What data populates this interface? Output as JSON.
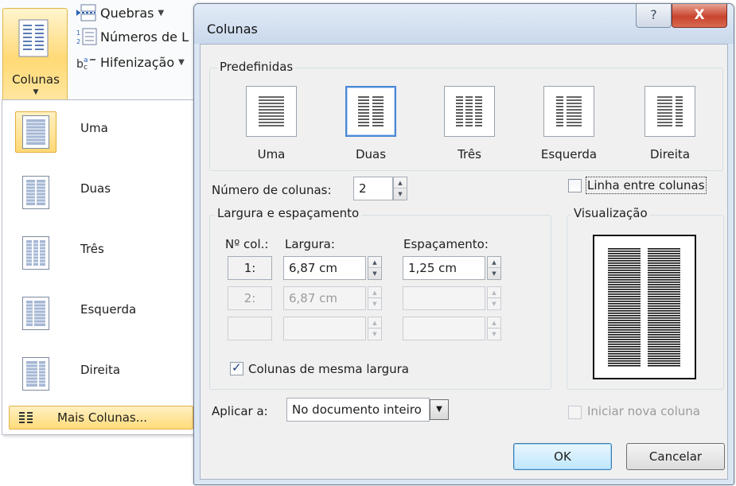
{
  "ribbon": {
    "colunas_label": "Colunas",
    "quebras_label": "Quebras",
    "numeros_label": "Números de L",
    "hifenizacao_label": "Hifenização"
  },
  "menu": {
    "items": [
      {
        "label": "Uma"
      },
      {
        "label": "Duas"
      },
      {
        "label": "Três"
      },
      {
        "label": "Esquerda"
      },
      {
        "label": "Direita"
      }
    ],
    "more": "Mais Colunas..."
  },
  "dialog": {
    "title": "Colunas",
    "help": "?",
    "close": "X",
    "predefinidas": {
      "title": "Predefinidas",
      "presets": [
        {
          "label": "Uma"
        },
        {
          "label": "Duas"
        },
        {
          "label": "Três"
        },
        {
          "label": "Esquerda"
        },
        {
          "label": "Direita"
        }
      ],
      "selected": "Duas"
    },
    "numero_colunas_label": "Número de colunas:",
    "numero_colunas_value": "2",
    "linha_entre_colunas": "Linha entre colunas",
    "largura_espacamento": {
      "title": "Largura e espaçamento",
      "col_header": "Nº col.:",
      "largura_header": "Largura:",
      "espacamento_header": "Espaçamento:",
      "rows": [
        {
          "num": "1:",
          "largura": "6,87 cm",
          "espacamento": "1,25 cm"
        },
        {
          "num": "2:",
          "largura": "6,87 cm",
          "espacamento": ""
        },
        {
          "num": "",
          "largura": "",
          "espacamento": ""
        }
      ],
      "mesma_largura": "Colunas de mesma largura"
    },
    "visualizacao": "Visualização",
    "aplicar_label": "Aplicar a:",
    "aplicar_value": "No documento inteiro",
    "iniciar_nova_coluna": "Iniciar nova coluna",
    "ok": "OK",
    "cancelar": "Cancelar"
  },
  "colors": {
    "highlight": "#ffd875",
    "dialog_frame": "#dbe6f3",
    "selected_preset_border": "#4a88d6",
    "close_button": "#c9442e"
  }
}
